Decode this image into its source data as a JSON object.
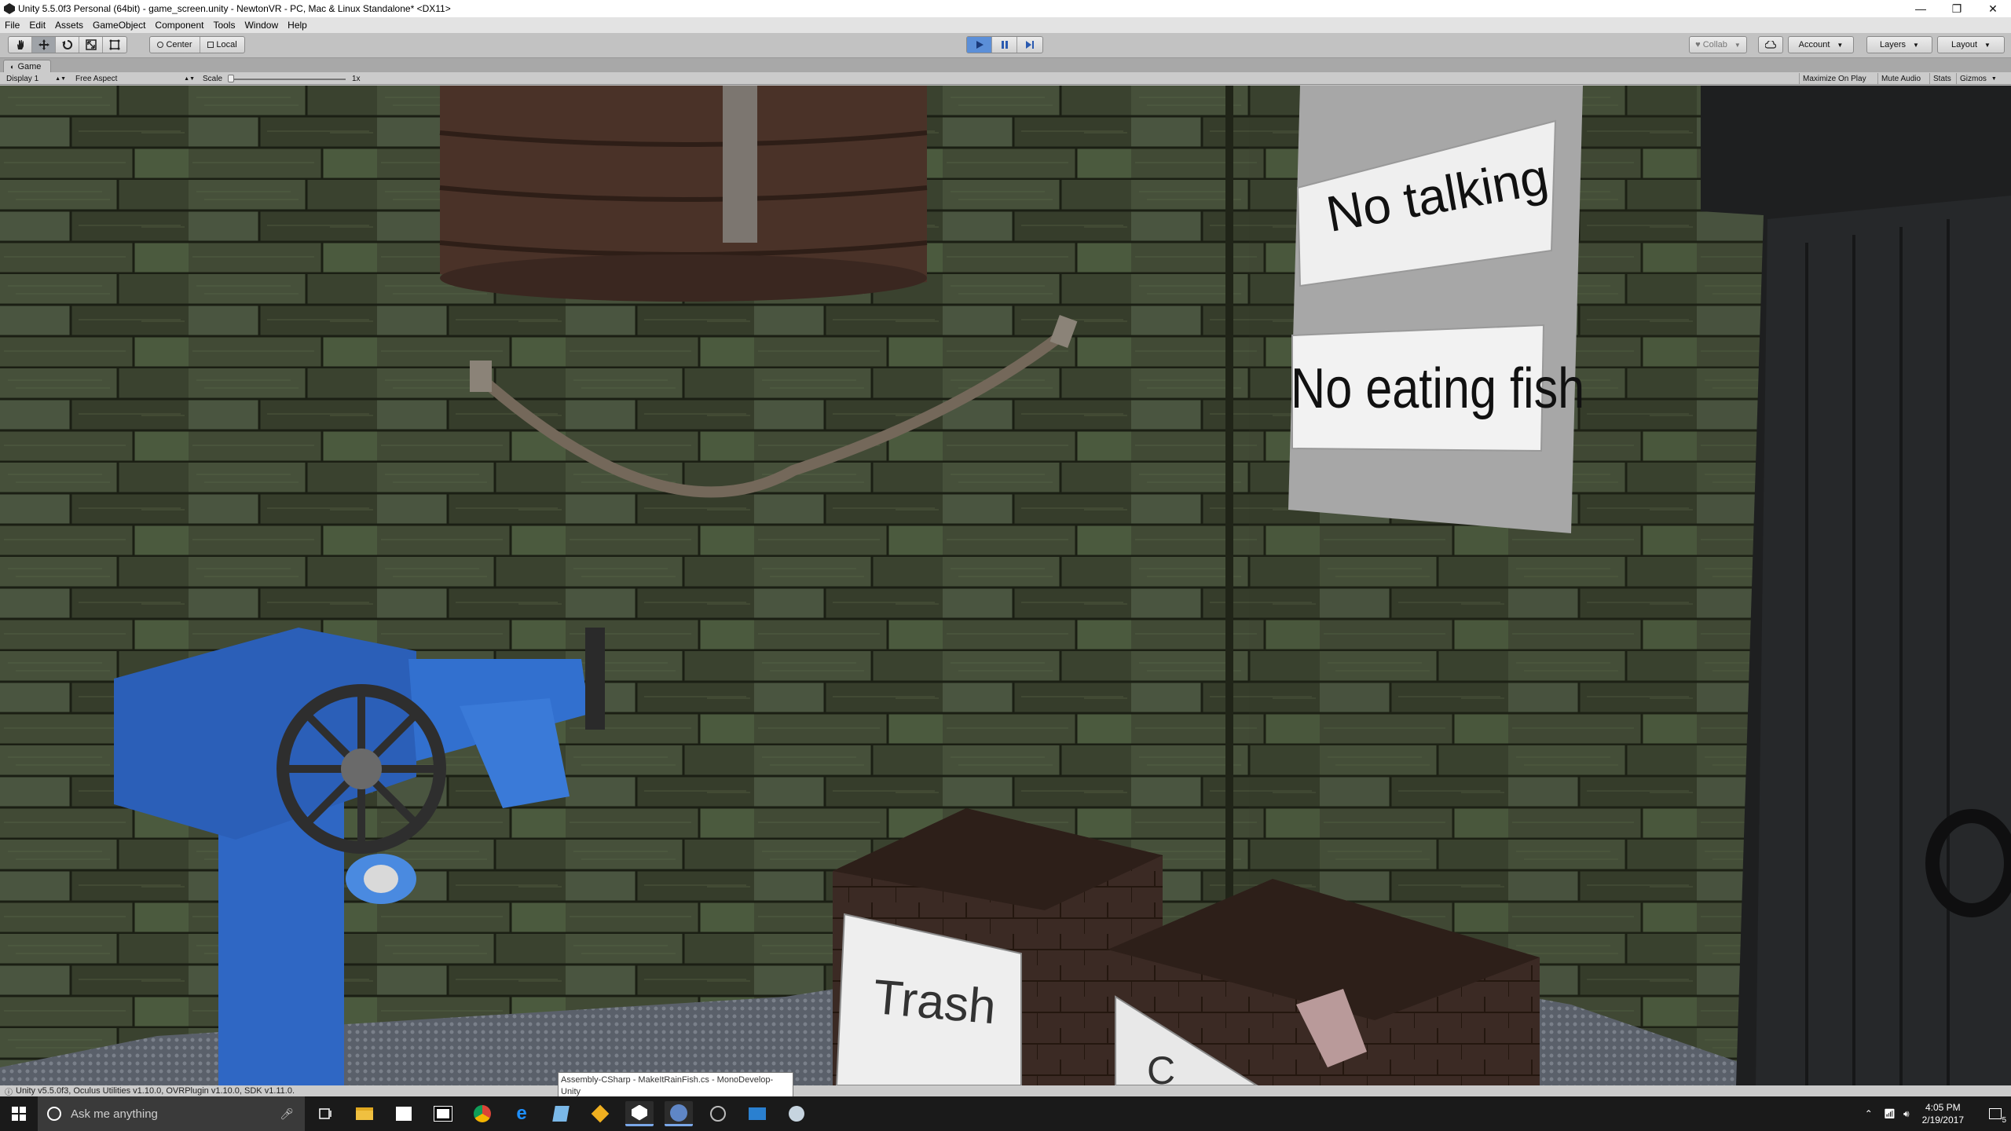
{
  "window": {
    "title": "Unity 5.5.0f3 Personal (64bit) - game_screen.unity - NewtonVR - PC, Mac & Linux Standalone* <DX11>",
    "minimize_glyph": "—",
    "restore_glyph": "❐",
    "close_glyph": "✕"
  },
  "menu": {
    "items": [
      "File",
      "Edit",
      "Assets",
      "GameObject",
      "Component",
      "Tools",
      "Window",
      "Help"
    ]
  },
  "toolbar": {
    "pivot_label": "Center",
    "space_label": "Local",
    "collab_label": "Collab",
    "account_label": "Account",
    "layers_label": "Layers",
    "layout_label": "Layout",
    "play_state": "playing"
  },
  "game_view": {
    "tab_label": "Game",
    "display_label": "Display 1",
    "aspect_label": "Free Aspect",
    "scale_label": "Scale",
    "scale_value": "1x",
    "maximize_label": "Maximize On Play",
    "mute_label": "Mute Audio",
    "stats_label": "Stats",
    "gizmos_label": "Gizmos"
  },
  "scene": {
    "sign_top": "No talking",
    "sign_bottom": "No eating fish",
    "crate_label": "Trash",
    "crate2_label": "C"
  },
  "status": {
    "text": "Unity v5.5.0f3, Oculus Utilities v1.10.0, OVRPlugin v1.10.0, SDK v1.11.0."
  },
  "taskbar": {
    "search_placeholder": "Ask me anything",
    "tooltip_line1": "Assembly-CSharp - MakeItRainFish.cs - MonoDevelop-",
    "tooltip_line2": "Unity",
    "time": "4:05 PM",
    "date": "2/19/2017",
    "notification_count": "5"
  },
  "colors": {
    "play_active": "#5b8fd8",
    "wall_dark": "#2f3424",
    "pipe_blue": "#2f67c4",
    "taskbar": "#1a1a1a"
  }
}
